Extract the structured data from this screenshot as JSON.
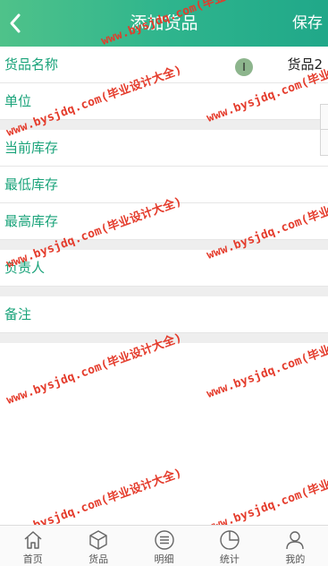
{
  "header": {
    "title": "添加货品",
    "save_label": "保存"
  },
  "form": {
    "name_label": "货品名称",
    "name_value": "货品2",
    "unit_label": "单位",
    "current_stock_label": "当前库存",
    "min_stock_label": "最低库存",
    "max_stock_label": "最高库存",
    "owner_label": "负责人",
    "remark_label": "备注"
  },
  "watermark": "www.bysjdq.com(毕业设计大全)",
  "tabbar": {
    "items": [
      {
        "label": "首页",
        "icon": "home-icon"
      },
      {
        "label": "货品",
        "icon": "box-icon"
      },
      {
        "label": "明细",
        "icon": "list-icon"
      },
      {
        "label": "统计",
        "icon": "pie-chart-icon"
      },
      {
        "label": "我的",
        "icon": "user-icon"
      }
    ]
  },
  "colors": {
    "header_start": "#4fc28a",
    "header_end": "#20a889",
    "label_green": "#1aa37a",
    "watermark_red": "#e43a2a"
  }
}
